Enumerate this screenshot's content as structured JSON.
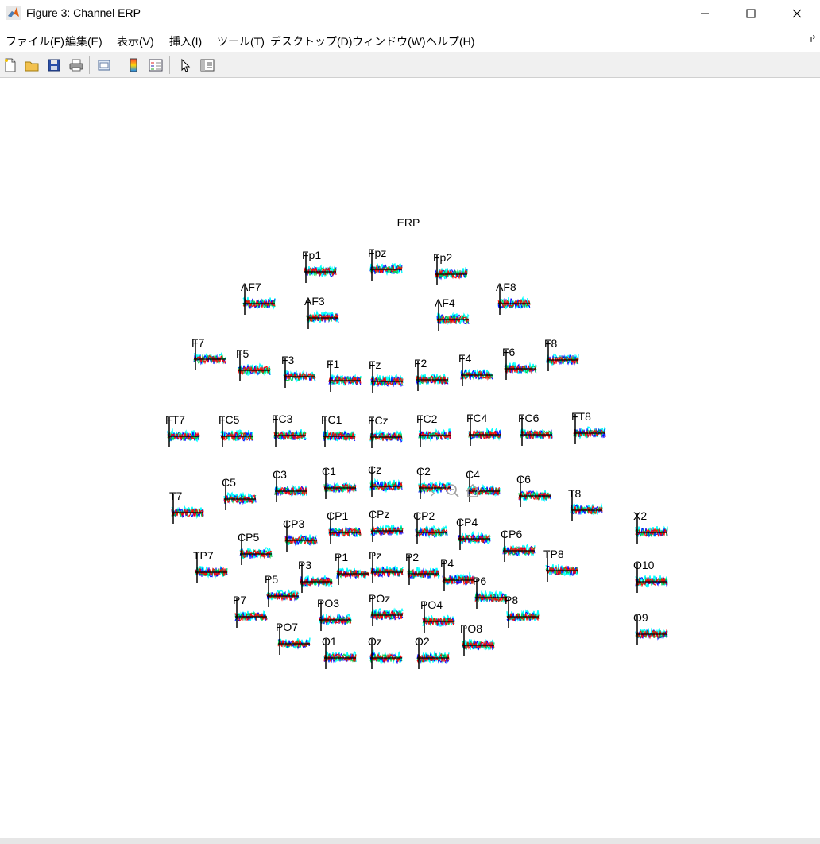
{
  "window": {
    "title": "Figure 3: Channel ERP"
  },
  "menu": [
    "ファイル(F)",
    "編集(E)",
    "表示(V)",
    "挿入(I)",
    "ツール(T)",
    "デスクトップ(D)",
    "ウィンドウ(W)",
    "ヘルプ(H)"
  ],
  "toolbar": [
    "new-figure-icon",
    "open-file-icon",
    "save-icon",
    "print-icon",
    "link-plot-icon",
    "colorbar-icon",
    "legend-icon",
    "pointer-icon",
    "property-inspector-icon"
  ],
  "axes_toolbar": [
    "expand-icon",
    "zoom-out-icon",
    "home-icon"
  ],
  "colors": {
    "trace": [
      "#00ffff",
      "#0000ff",
      "#00cc44",
      "#ff0000"
    ],
    "axis": "#000000"
  },
  "chart_data": {
    "type": "line",
    "title": "ERP",
    "channels": [
      "Fp1",
      "Fpz",
      "Fp2",
      "AF7",
      "AF3",
      "AF4",
      "AF8",
      "F7",
      "F5",
      "F3",
      "F1",
      "Fz",
      "F2",
      "F4",
      "F6",
      "F8",
      "FT7",
      "FC5",
      "FC3",
      "FC1",
      "FCz",
      "FC2",
      "FC4",
      "FC6",
      "FT8",
      "T7",
      "C5",
      "C3",
      "C1",
      "Cz",
      "C2",
      "C4",
      "C6",
      "T8",
      "X2",
      "CP5",
      "CP3",
      "CP1",
      "CPz",
      "CP2",
      "CP4",
      "CP6",
      "TP7",
      "TP8",
      "P7",
      "P5",
      "P3",
      "P1",
      "Pz",
      "P2",
      "P4",
      "P6",
      "P8",
      "PO7",
      "PO3",
      "POz",
      "PO4",
      "PO8",
      "O1",
      "Oz",
      "O2",
      "O10",
      "O9"
    ]
  }
}
